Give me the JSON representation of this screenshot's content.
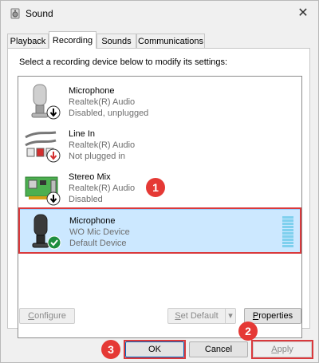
{
  "window": {
    "title": "Sound",
    "close_label": "✕"
  },
  "tabs": [
    {
      "label": "Playback",
      "active": false
    },
    {
      "label": "Recording",
      "active": true
    },
    {
      "label": "Sounds",
      "active": false
    },
    {
      "label": "Communications",
      "active": false
    }
  ],
  "panel": {
    "instruction": "Select a recording device below to modify its settings:"
  },
  "devices": [
    {
      "name": "Microphone",
      "driver": "Realtek(R) Audio",
      "status": "Disabled, unplugged",
      "icon": "microphone-icon",
      "overlay": "down-arrow-badge-icon"
    },
    {
      "name": "Line In",
      "driver": "Realtek(R) Audio",
      "status": "Not plugged in",
      "icon": "line-in-jack-icon",
      "overlay": "red-down-arrow-badge-icon"
    },
    {
      "name": "Stereo Mix",
      "driver": "Realtek(R) Audio",
      "status": "Disabled",
      "icon": "sound-card-icon",
      "overlay": "down-arrow-badge-icon"
    },
    {
      "name": "Microphone",
      "driver": "WO Mic Device",
      "status": "Default Device",
      "icon": "microphone-icon",
      "overlay": "green-check-badge-icon",
      "selected": true
    }
  ],
  "buttons": {
    "configure": "Configure",
    "set_default": "Set Default",
    "properties": "Properties",
    "ok": "OK",
    "cancel": "Cancel",
    "apply": "Apply"
  },
  "annotations": [
    "1",
    "2",
    "3"
  ],
  "colors": {
    "selection_bg": "#cce8ff",
    "annotation_red": "#e53935",
    "default_green": "#1e8e3e"
  }
}
